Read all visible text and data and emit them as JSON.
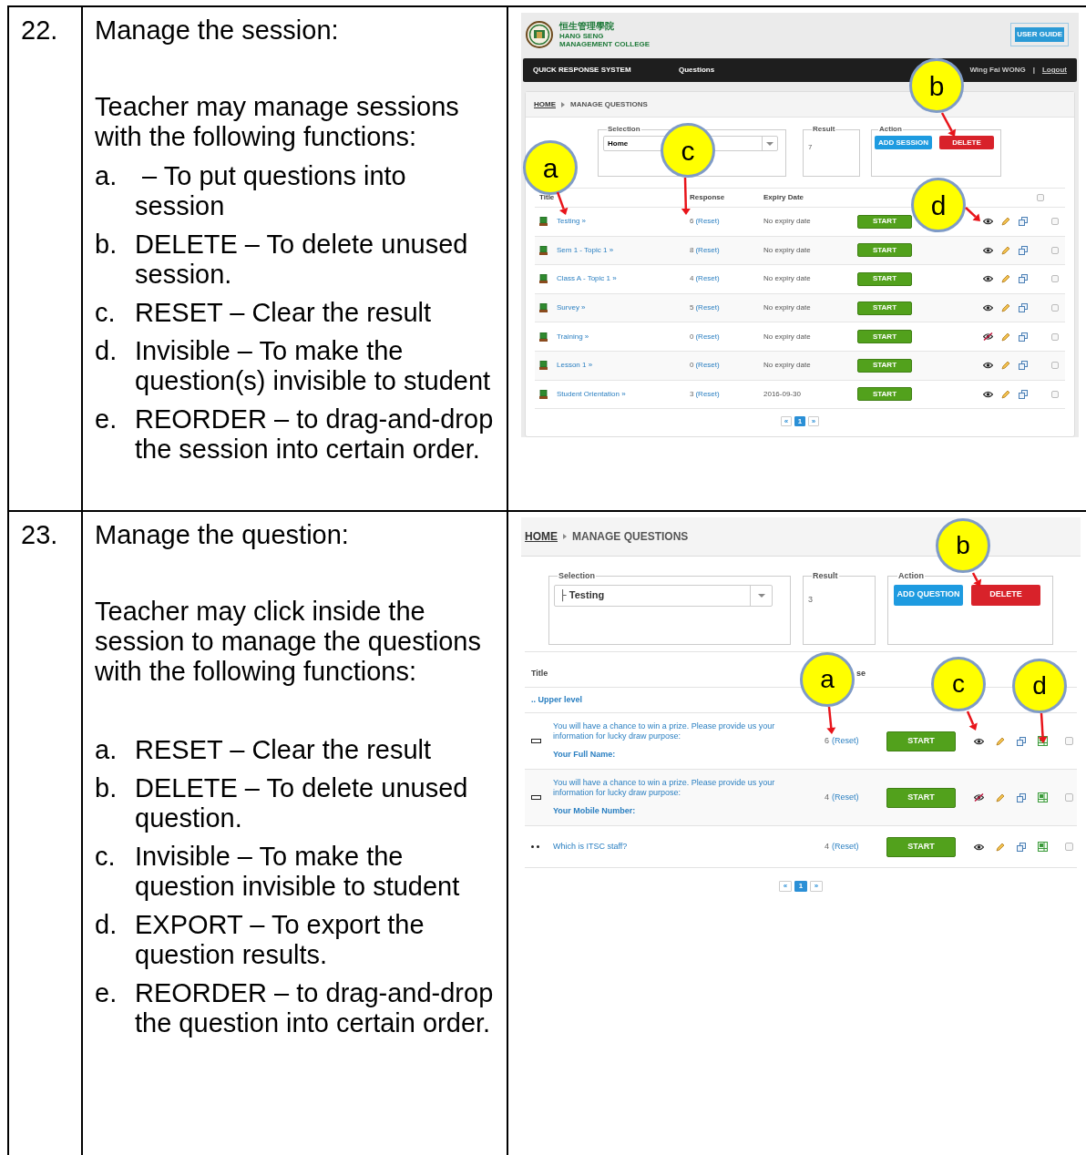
{
  "rows": [
    {
      "number": "22.",
      "heading": "Manage the session:",
      "intro": "Teacher may manage sessions with the following functions:",
      "items": [
        {
          "letter": "a.",
          "text": " – To put questions into session"
        },
        {
          "letter": "b.",
          "text": "DELETE – To delete unused session."
        },
        {
          "letter": "c.",
          "text": "RESET – Clear the result"
        },
        {
          "letter": "d.",
          "text": "Invisible – To make the question(s) invisible to student"
        },
        {
          "letter": "e.",
          "text": "REORDER – to drag-and-drop the session into certain order."
        }
      ],
      "screen": {
        "kind": "sessions",
        "header": {
          "college_name_cn": "恒生管理學院",
          "college_name_en": [
            "HANG SENG",
            "MANAGEMENT COLLEGE"
          ],
          "user_guide": "USER GUIDE"
        },
        "nav": {
          "brand": "QUICK RESPONSE SYSTEM",
          "menu": "Questions",
          "user": "Wing Fai WONG",
          "separator": "|",
          "logout": "Logout"
        },
        "breadcrumb": [
          "HOME",
          "MANAGE QUESTIONS"
        ],
        "selection": {
          "legend": "Selection",
          "value": "Home"
        },
        "result": {
          "legend": "Result",
          "value": "7"
        },
        "action": {
          "legend": "Action",
          "buttons": [
            "ADD SESSION",
            "DELETE"
          ]
        },
        "columns": [
          "Title",
          "Response",
          "Expiry Date"
        ],
        "all_checked": false,
        "list": [
          {
            "title": "Testing »",
            "count": "6",
            "reset": "(Reset)",
            "expiry": "No expiry date",
            "start": "START",
            "visible": true,
            "checked": false
          },
          {
            "title": "Sem 1 - Topic 1 »",
            "count": "8",
            "reset": "(Reset)",
            "expiry": "No expiry date",
            "start": "START",
            "visible": true,
            "checked": false
          },
          {
            "title": "Class A - Topic 1 »",
            "count": "4",
            "reset": "(Reset)",
            "expiry": "No expiry date",
            "start": "START",
            "visible": true,
            "checked": false
          },
          {
            "title": "Survey »",
            "count": "5",
            "reset": "(Reset)",
            "expiry": "No expiry date",
            "start": "START",
            "visible": true,
            "checked": false
          },
          {
            "title": "Training »",
            "count": "0",
            "reset": "(Reset)",
            "expiry": "No expiry date",
            "start": "START",
            "visible": false,
            "checked": false
          },
          {
            "title": "Lesson 1 »",
            "count": "0",
            "reset": "(Reset)",
            "expiry": "No expiry date",
            "start": "START",
            "visible": true,
            "checked": false
          },
          {
            "title": "Student Orientation »",
            "count": "3",
            "reset": "(Reset)",
            "expiry": "2016-09-30",
            "start": "START",
            "visible": true,
            "checked": false
          }
        ],
        "pager": [
          {
            "label": "«",
            "selected": false
          },
          {
            "label": "1",
            "selected": true
          },
          {
            "label": "»",
            "selected": false
          }
        ],
        "callouts": [
          "a",
          "b",
          "c",
          "d"
        ]
      }
    },
    {
      "number": "23.",
      "heading": "Manage the question:",
      "intro": "Teacher may click inside the session to manage the questions with the following functions:",
      "items": [
        {
          "letter": "a.",
          "text": "RESET – Clear the result"
        },
        {
          "letter": "b.",
          "text": "DELETE – To delete unused question."
        },
        {
          "letter": "c.",
          "text": "Invisible – To make the question invisible to student"
        },
        {
          "letter": "d.",
          "text": "EXPORT – To export the question results."
        },
        {
          "letter": "e.",
          "text": "REORDER – to drag-and-drop the question into certain order."
        }
      ],
      "screen": {
        "kind": "questions",
        "breadcrumb": [
          "HOME",
          "MANAGE QUESTIONS"
        ],
        "selection": {
          "legend": "Selection",
          "value": "├ Testing"
        },
        "result": {
          "legend": "Result",
          "value": "3"
        },
        "action": {
          "legend": "Action",
          "buttons": [
            "ADD QUESTION",
            "DELETE"
          ]
        },
        "columns": [
          "Title",
          "se"
        ],
        "upper_level": ".. Upper level",
        "list": [
          {
            "kind": "text",
            "question": "You will have a chance to win a prize. Please provide us your information for lucky draw purpose:",
            "field": "Your Full Name:",
            "count": "6",
            "reset": "(Reset)",
            "start": "START",
            "visible": true,
            "checked": false
          },
          {
            "kind": "text",
            "question": "You will have a chance to win a prize. Please provide us your information for lucky draw purpose:",
            "field": "Your Mobile Number:",
            "count": "4",
            "reset": "(Reset)",
            "start": "START",
            "visible": false,
            "checked": false
          },
          {
            "kind": "choice",
            "question": "Which is ITSC staff?",
            "count": "4",
            "reset": "(Reset)",
            "start": "START",
            "visible": true,
            "checked": false
          }
        ],
        "pager": [
          {
            "label": "«",
            "selected": false
          },
          {
            "label": "1",
            "selected": true
          },
          {
            "label": "»",
            "selected": false
          }
        ],
        "callouts": [
          "a",
          "b",
          "c",
          "d"
        ]
      }
    }
  ]
}
